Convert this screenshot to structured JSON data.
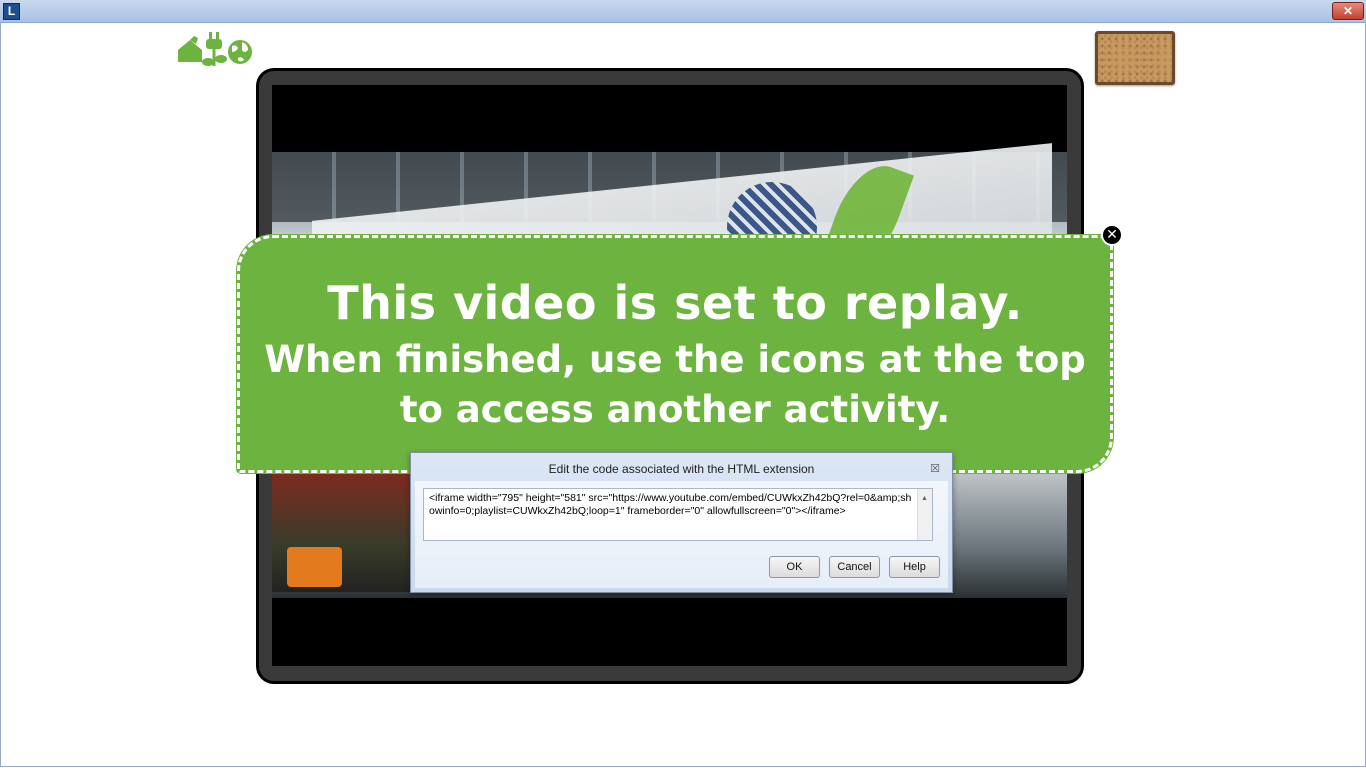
{
  "window": {
    "app_icon_letter": "L",
    "close_glyph": "✕"
  },
  "top_icons": [
    "home-leaf-icon",
    "plug-leaf-icon",
    "globe-icon"
  ],
  "corkboard": "corkboard-icon",
  "callout": {
    "line1": "This video is set to replay.",
    "line2": "When finished, use the icons at the top",
    "line3": "to access another activity.",
    "close_glyph": "✕",
    "color": "#6db33f"
  },
  "dialog": {
    "title": "Edit the code associated with the HTML extension",
    "close_glyph": "☒",
    "code": "<iframe width=\"795\" height=\"581\" src=\"https://www.youtube.com/embed/CUWkxZh42bQ?rel=0&amp;showinfo=0;playlist=CUWkxZh42bQ;loop=1\" frameborder=\"0\" allowfullscreen=\"0\"></iframe>",
    "ok_label": "OK",
    "cancel_label": "Cancel",
    "help_label": "Help"
  }
}
